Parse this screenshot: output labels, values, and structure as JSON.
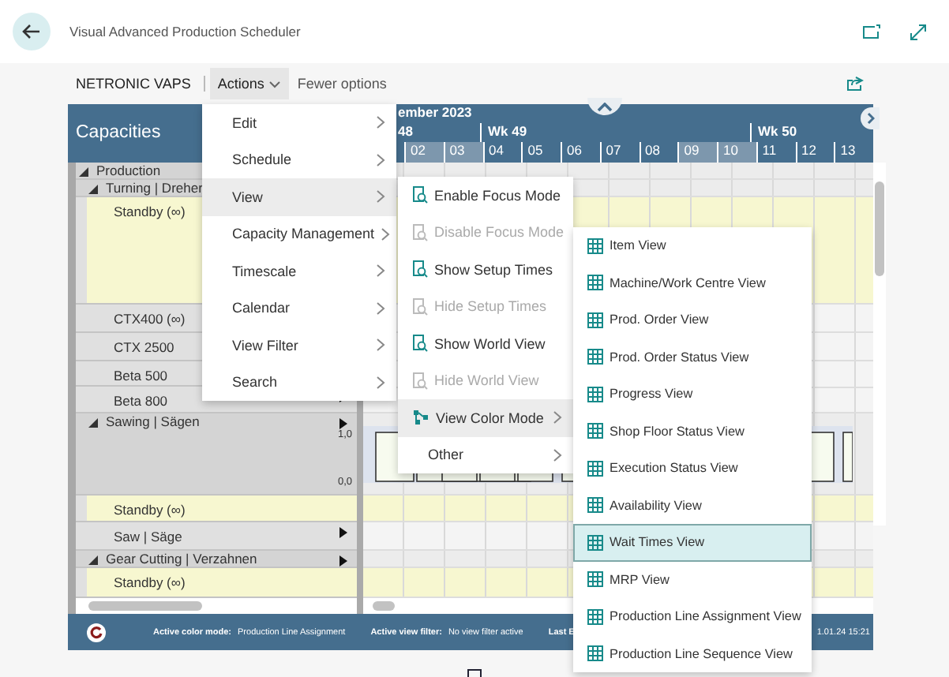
{
  "header": {
    "title": "Visual Advanced Production Scheduler"
  },
  "command_bar": [
    {
      "label": "NETRONIC VAPS",
      "kind": "text",
      "expanded": false
    },
    {
      "label": "Actions",
      "kind": "dropdown",
      "expanded": true
    },
    {
      "label": "Fewer options",
      "kind": "button",
      "expanded": false
    }
  ],
  "gantt": {
    "panel_title": "Capacities",
    "timeline": {
      "month": "ember 2023",
      "weeks": [
        {
          "label": "48"
        },
        {
          "label": "Wk 49"
        },
        {
          "label": "Wk 50"
        }
      ],
      "days": [
        {
          "label": "02",
          "shaded": true
        },
        {
          "label": "03",
          "shaded": true
        },
        {
          "label": "04",
          "shaded": false
        },
        {
          "label": "05",
          "shaded": false
        },
        {
          "label": "06",
          "shaded": false
        },
        {
          "label": "07",
          "shaded": false
        },
        {
          "label": "08",
          "shaded": false
        },
        {
          "label": "09",
          "shaded": true
        },
        {
          "label": "10",
          "shaded": true
        },
        {
          "label": "11",
          "shaded": false
        },
        {
          "label": "12",
          "shaded": false
        },
        {
          "label": "13",
          "shaded": false
        }
      ]
    },
    "tree": [
      {
        "label": "Production",
        "kind": "group",
        "expanded": true,
        "children": [
          {
            "label": "Turning | Dreher",
            "kind": "group",
            "expanded": true,
            "children": [
              {
                "label": "Standby (∞)",
                "kind": "standby"
              },
              {
                "label": "CTX400 (∞)",
                "kind": "resource"
              },
              {
                "label": "CTX 2500",
                "kind": "resource"
              },
              {
                "label": "Beta 500",
                "kind": "resource"
              },
              {
                "label": "Beta 800",
                "kind": "resource",
                "marker": true
              }
            ]
          },
          {
            "label": "Sawing | Sägen",
            "kind": "group",
            "expanded": true,
            "marker": true,
            "axis": [
              "1,0",
              "0,0"
            ],
            "children": [
              {
                "label": "Standby (∞)",
                "kind": "standby",
                "marker": false
              },
              {
                "label": "Saw | Säge",
                "kind": "resource",
                "marker": true
              }
            ]
          },
          {
            "label": "Gear Cutting | Verzahnen",
            "kind": "group",
            "expanded": true,
            "marker": true,
            "children": [
              {
                "label": "Standby (∞)",
                "kind": "standby",
                "marker": false
              }
            ]
          }
        ]
      }
    ],
    "status_bar": [
      {
        "label": "Active color mode:",
        "value": "Production Line Assignment"
      },
      {
        "label": "Active view filter:",
        "value": "No view filter active"
      },
      {
        "label": "Last E"
      }
    ],
    "status_time": "1.01.24 15:21"
  },
  "actions_menu": [
    {
      "label": "Edit",
      "selected": false
    },
    {
      "label": "Schedule",
      "selected": false
    },
    {
      "label": "View",
      "selected": true
    },
    {
      "label": "Capacity Management",
      "selected": false
    },
    {
      "label": "Timescale",
      "selected": false
    },
    {
      "label": "Calendar",
      "selected": false
    },
    {
      "label": "View Filter",
      "selected": false
    },
    {
      "label": "Search",
      "selected": false
    }
  ],
  "view_menu": [
    {
      "label": "Enable Focus Mode",
      "kind": "toggle",
      "disabled": false,
      "selected": false
    },
    {
      "label": "Disable Focus Mode",
      "kind": "toggle",
      "disabled": true,
      "selected": false
    },
    {
      "label": "Show Setup Times",
      "kind": "toggle",
      "disabled": false,
      "selected": false
    },
    {
      "label": "Hide Setup Times",
      "kind": "toggle",
      "disabled": true,
      "selected": false
    },
    {
      "label": "Show World View",
      "kind": "toggle",
      "disabled": false,
      "selected": false
    },
    {
      "label": "Hide World View",
      "kind": "toggle",
      "disabled": true,
      "selected": false
    },
    {
      "label": "View Color Mode",
      "kind": "color-mode",
      "disabled": false,
      "selected": true
    },
    {
      "label": "Other",
      "kind": "plain",
      "disabled": false,
      "selected": false
    }
  ],
  "color_mode_menu": [
    {
      "label": "Item View",
      "selected": false
    },
    {
      "label": "Machine/Work Centre View",
      "selected": false
    },
    {
      "label": "Prod. Order View",
      "selected": false
    },
    {
      "label": "Prod. Order Status View",
      "selected": false
    },
    {
      "label": "Progress View",
      "selected": false
    },
    {
      "label": "Shop Floor Status View",
      "selected": false
    },
    {
      "label": "Execution Status View",
      "selected": false
    },
    {
      "label": "Availability View",
      "selected": false
    },
    {
      "label": "Wait Times View",
      "selected": true
    },
    {
      "label": "MRP View",
      "selected": false
    },
    {
      "label": "Production Line Assignment View",
      "selected": false
    },
    {
      "label": "Production Line Sequence View",
      "selected": false
    }
  ]
}
